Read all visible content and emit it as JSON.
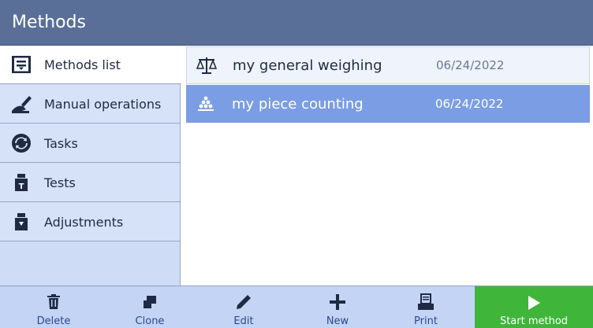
{
  "header": {
    "title": "Methods"
  },
  "sidebar": {
    "items": [
      {
        "label": "Methods list",
        "icon": "methods-list-icon",
        "active": true
      },
      {
        "label": "Manual operations",
        "icon": "manual-operations-icon",
        "active": false
      },
      {
        "label": "Tasks",
        "icon": "tasks-icon",
        "active": false
      },
      {
        "label": "Tests",
        "icon": "tests-weight-icon",
        "active": false
      },
      {
        "label": "Adjustments",
        "icon": "adjustments-weight-icon",
        "active": false
      }
    ]
  },
  "methods": [
    {
      "name": "my general weighing",
      "date": "06/24/2022",
      "icon": "balance-scale-icon",
      "selected": false
    },
    {
      "name": "my piece counting",
      "date": "06/24/2022",
      "icon": "piece-counting-icon",
      "selected": true
    }
  ],
  "toolbar": {
    "delete": "Delete",
    "clone": "Clone",
    "edit": "Edit",
    "new": "New",
    "print": "Print",
    "start": "Start method"
  },
  "colors": {
    "header_bg": "#5a6f97",
    "sidebar_bg": "#d6e2f8",
    "selected_row": "#7a9de3",
    "toolbar_bg": "#c4d4f4",
    "start_button": "#3fb53a"
  }
}
